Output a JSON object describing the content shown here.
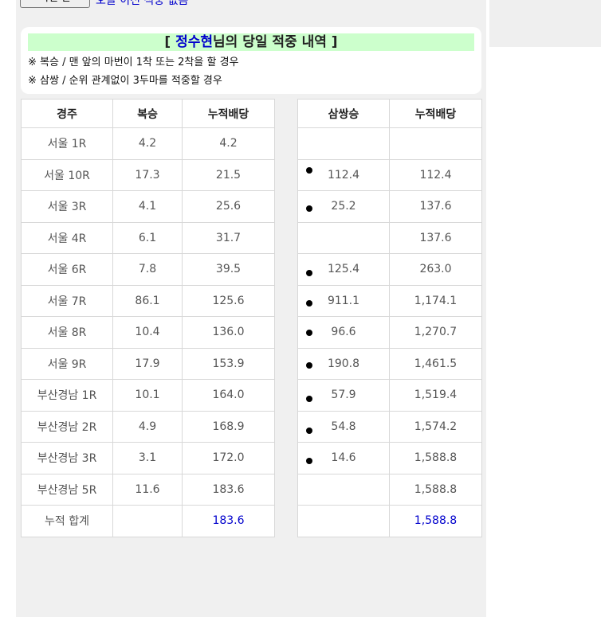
{
  "top": {
    "button_label": "이전 날",
    "link_text": "오늘 이전 적중 없음"
  },
  "header": {
    "title_prefix": "[ ",
    "user_name": "정수현",
    "title_suffix": "님의 당일 적중 내역 ]",
    "note1": "※ 복승 / 맨 앞의 마번이 1착 또는 2착을 할 경우",
    "note2": "※ 삼쌍 / 순위 관계없이 3두마를 적중할 경우"
  },
  "left_table": {
    "headers": [
      "경주",
      "복승",
      "누적배당"
    ],
    "rows": [
      [
        "서울 1R",
        "4.2",
        "4.2"
      ],
      [
        "서울 10R",
        "17.3",
        "21.5"
      ],
      [
        "서울 3R",
        "4.1",
        "25.6"
      ],
      [
        "서울 4R",
        "6.1",
        "31.7"
      ],
      [
        "서울 6R",
        "7.8",
        "39.5"
      ],
      [
        "서울 7R",
        "86.1",
        "125.6"
      ],
      [
        "서울 8R",
        "10.4",
        "136.0"
      ],
      [
        "서울 9R",
        "17.9",
        "153.9"
      ],
      [
        "부산경남 1R",
        "10.1",
        "164.0"
      ],
      [
        "부산경남 2R",
        "4.9",
        "168.9"
      ],
      [
        "부산경남 3R",
        "3.1",
        "172.0"
      ],
      [
        "부산경남 5R",
        "11.6",
        "183.6"
      ]
    ],
    "total": [
      "누적 합계",
      "",
      "183.6"
    ]
  },
  "right_table": {
    "headers": [
      "삼쌍승",
      "누적배당"
    ],
    "rows": [
      [
        "",
        ""
      ],
      [
        "112.4",
        "112.4"
      ],
      [
        "25.2",
        "137.6"
      ],
      [
        "",
        "137.6"
      ],
      [
        "125.4",
        "263.0"
      ],
      [
        "911.1",
        "1,174.1"
      ],
      [
        "96.6",
        "1,270.7"
      ],
      [
        "190.8",
        "1,461.5"
      ],
      [
        "57.9",
        "1,519.4"
      ],
      [
        "54.8",
        "1,574.2"
      ],
      [
        "14.6",
        "1,588.8"
      ],
      [
        "",
        "1,588.8"
      ]
    ],
    "total": [
      "",
      "1,588.8"
    ]
  },
  "colors": {
    "title_bg": "#ccffcc",
    "accent_blue": "#0000cc",
    "panel_bg": "#f0f0f0"
  }
}
